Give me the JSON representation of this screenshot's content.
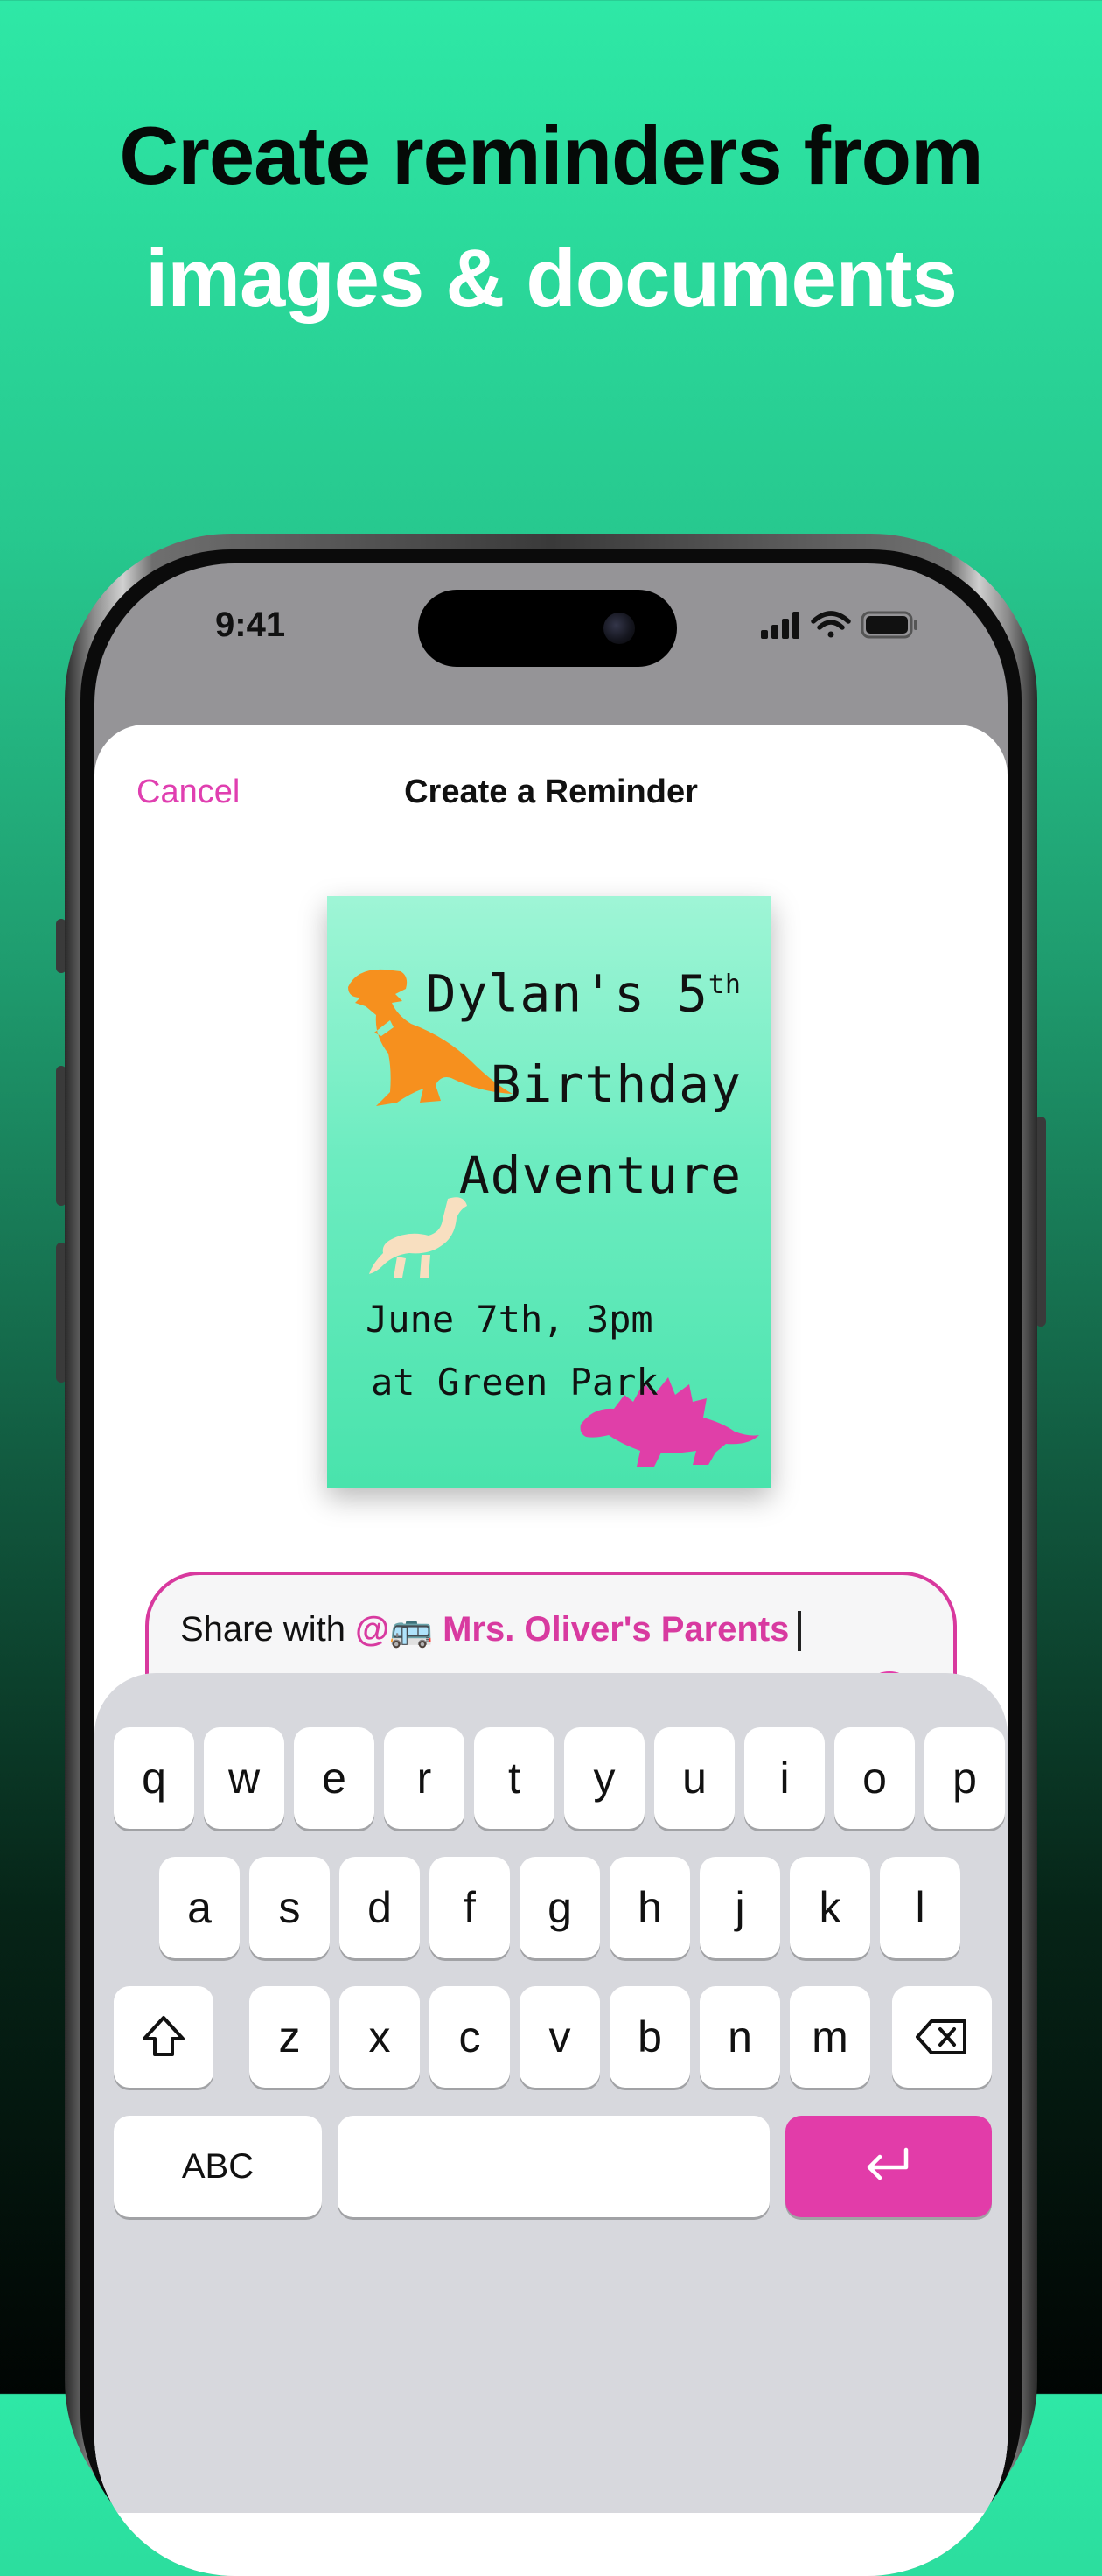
{
  "headline": {
    "line1": "Create reminders from",
    "line2": "images & documents"
  },
  "status_bar": {
    "time": "9:41",
    "icons": [
      "signal-icon",
      "wifi-icon",
      "battery-icon"
    ]
  },
  "nav": {
    "cancel": "Cancel",
    "title": "Create a Reminder"
  },
  "invitation": {
    "title_line1": "Dylan's 5",
    "title_sup": "th",
    "title_line2": "Birthday",
    "title_line3": "Adventure",
    "date_line": "June 7th, 3pm",
    "place_line": "at Green Park"
  },
  "composer": {
    "prefix": "Share with ",
    "mention_at": "@",
    "mention_emoji": "🚌",
    "mention_name": "Mrs. Oliver's Parents",
    "plus": "+",
    "at_button": "@"
  },
  "keyboard": {
    "row1": [
      "q",
      "w",
      "e",
      "r",
      "t",
      "y",
      "u",
      "i",
      "o",
      "p"
    ],
    "row2": [
      "a",
      "s",
      "d",
      "f",
      "g",
      "h",
      "j",
      "k",
      "l"
    ],
    "row3": [
      "z",
      "x",
      "c",
      "v",
      "b",
      "n",
      "m"
    ],
    "abc": "ABC"
  },
  "colors": {
    "accent": "#e23ca9",
    "background_top": "#2ee8a6",
    "background_bottom": "#010503"
  }
}
